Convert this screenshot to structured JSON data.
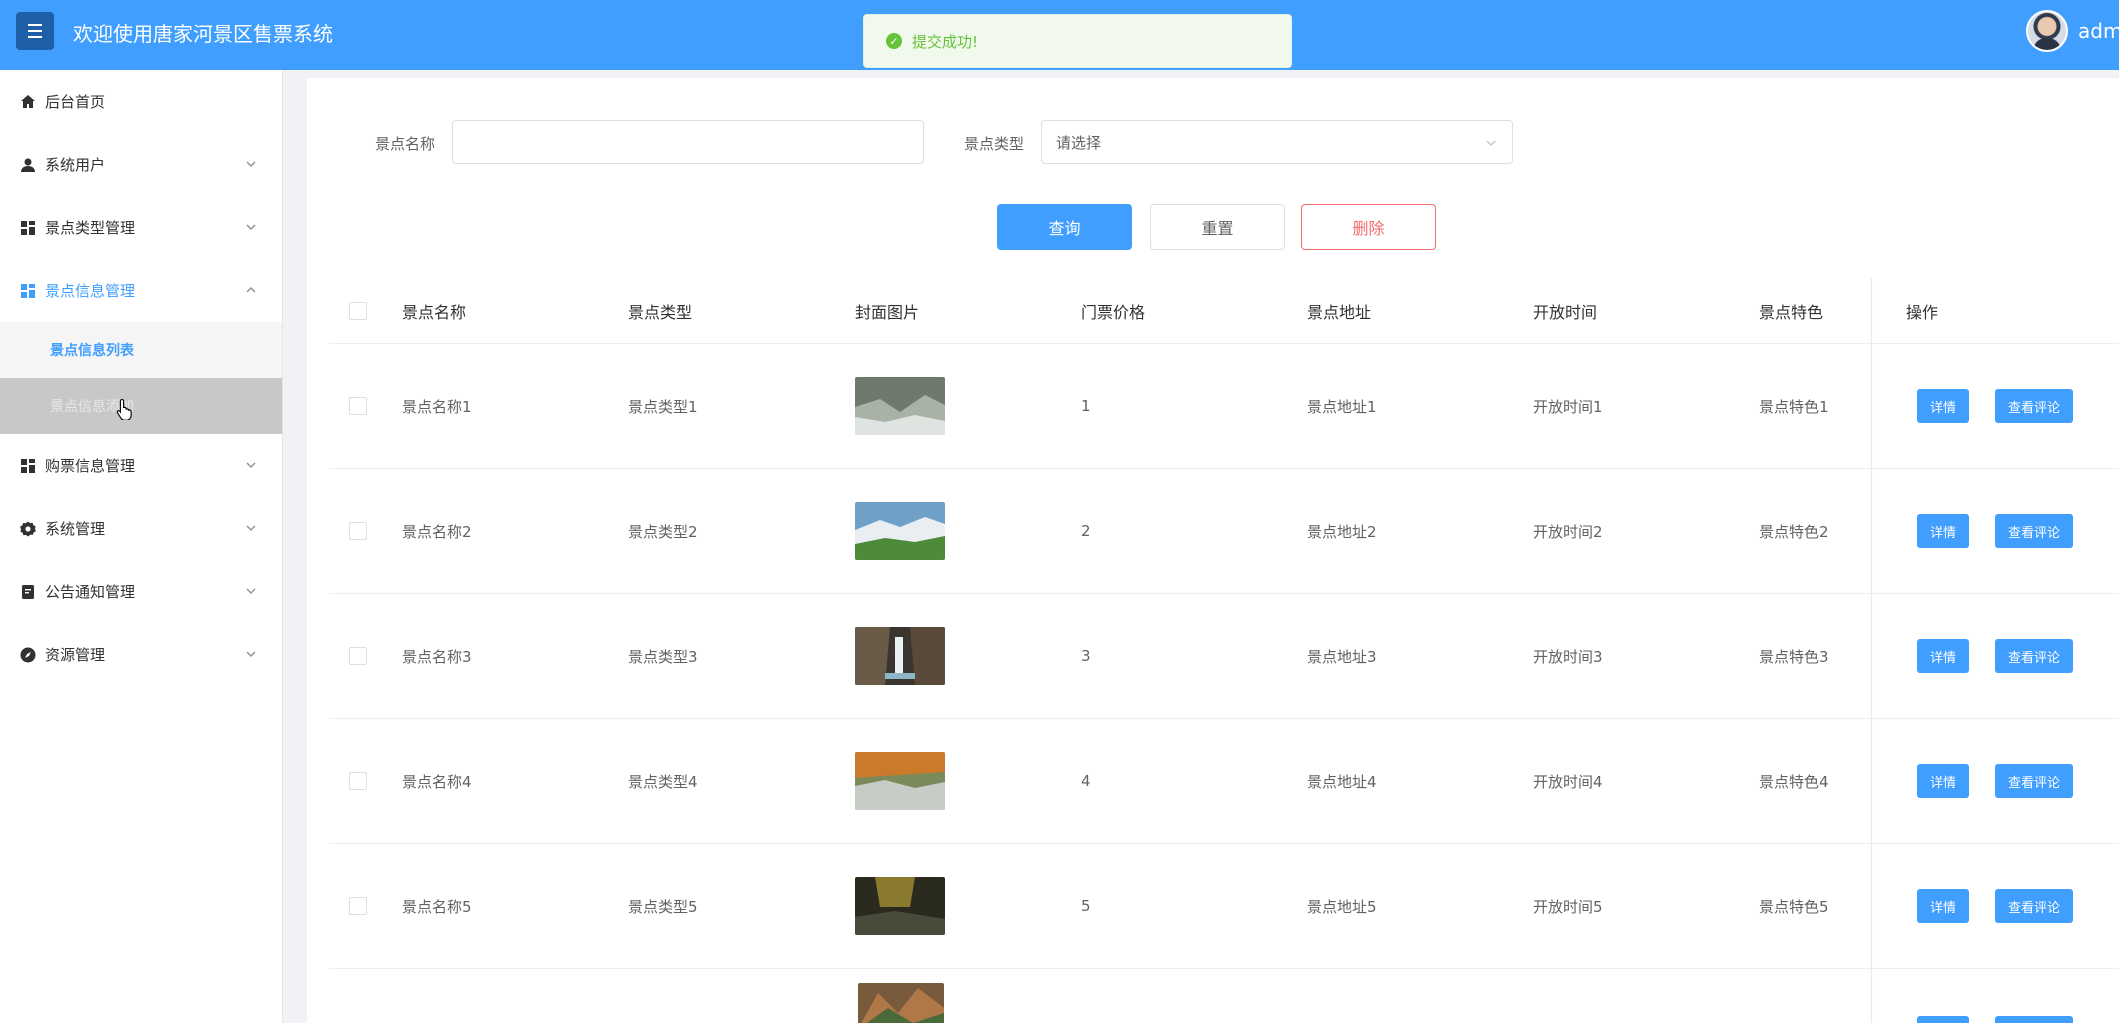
{
  "header": {
    "menu_icon": "hamburger-icon",
    "title": "欢迎使用唐家河景区售票系统",
    "username": "admin"
  },
  "toast": {
    "icon": "check-circle-icon",
    "message": "提交成功!",
    "color": "#67c23a"
  },
  "sidebar": {
    "items": [
      {
        "label": "后台首页",
        "icon": "home-icon"
      },
      {
        "label": "系统用户",
        "icon": "user-icon"
      },
      {
        "label": "景点类型管理",
        "icon": "grid-icon"
      },
      {
        "label": "景点信息管理",
        "icon": "grid-icon"
      },
      {
        "label": "购票信息管理",
        "icon": "grid-icon"
      },
      {
        "label": "系统管理",
        "icon": "gear-icon"
      },
      {
        "label": "公告通知管理",
        "icon": "document-icon"
      },
      {
        "label": "资源管理",
        "icon": "compass-icon"
      }
    ],
    "sub_items": [
      {
        "label": "景点信息列表"
      },
      {
        "label": "景点信息添加"
      }
    ]
  },
  "search": {
    "name_label": "景点名称",
    "name_value": "",
    "type_label": "景点类型",
    "type_placeholder": "请选择"
  },
  "actions": {
    "query": "查询",
    "reset": "重置",
    "delete": "删除"
  },
  "table": {
    "columns": [
      "景点名称",
      "景点类型",
      "封面图片",
      "门票价格",
      "景点地址",
      "开放时间",
      "景点特色",
      "操作"
    ],
    "rows": [
      {
        "name": "景点名称1",
        "type": "景点类型1",
        "price": "1",
        "address": "景点地址1",
        "hours": "开放时间1",
        "feature": "景点特色1"
      },
      {
        "name": "景点名称2",
        "type": "景点类型2",
        "price": "2",
        "address": "景点地址2",
        "hours": "开放时间2",
        "feature": "景点特色2"
      },
      {
        "name": "景点名称3",
        "type": "景点类型3",
        "price": "3",
        "address": "景点地址3",
        "hours": "开放时间3",
        "feature": "景点特色3"
      },
      {
        "name": "景点名称4",
        "type": "景点类型4",
        "price": "4",
        "address": "景点地址4",
        "hours": "开放时间4",
        "feature": "景点特色4"
      },
      {
        "name": "景点名称5",
        "type": "景点类型5",
        "price": "5",
        "address": "景点地址5",
        "hours": "开放时间5",
        "feature": "景点特色5"
      }
    ],
    "detail_button": "详情",
    "review_button": "查看评论"
  },
  "colors": {
    "primary": "#409eff",
    "danger": "#f56c6c",
    "success": "#67c23a"
  }
}
